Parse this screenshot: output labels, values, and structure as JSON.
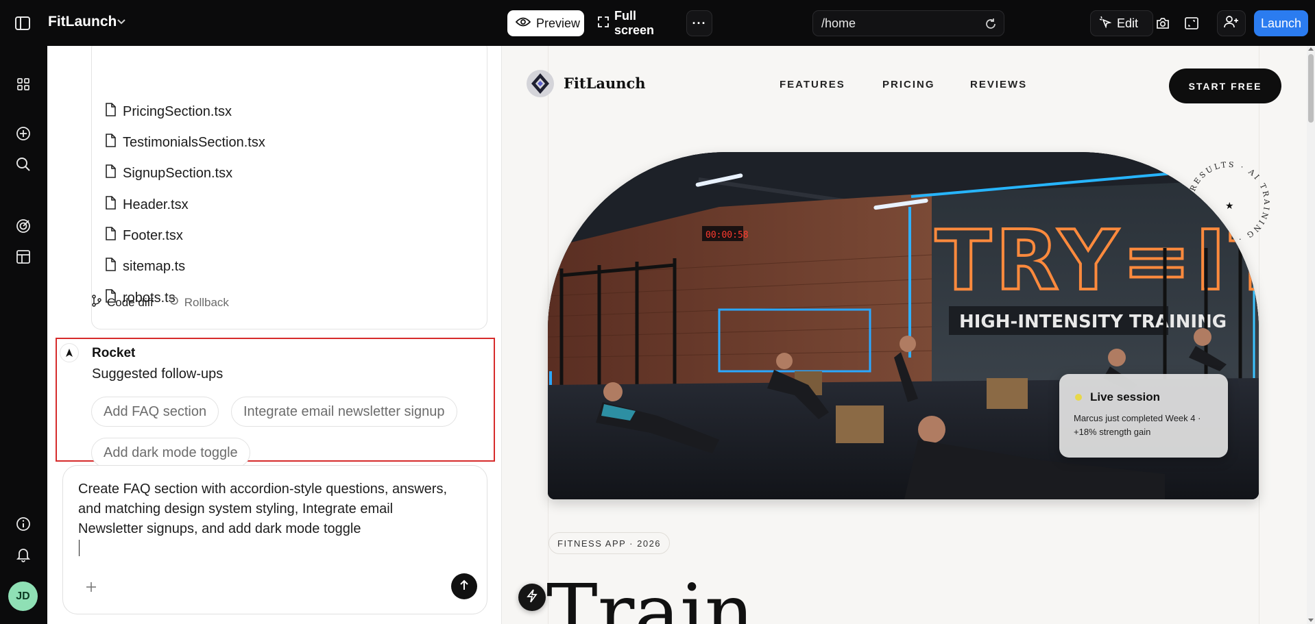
{
  "topbar": {
    "app_name": "FitLaunch",
    "preview_label": "Preview",
    "fullscreen_label": "Full screen",
    "url": "/home",
    "edit_label": "Edit",
    "launch_label": "Launch"
  },
  "user": {
    "initials": "JD"
  },
  "files": [
    "PricingSection.tsx",
    "TestimonialsSection.tsx",
    "SignupSection.tsx",
    "Header.tsx",
    "Footer.tsx",
    "sitemap.ts",
    "robots.ts"
  ],
  "file_actions": {
    "code_diff": "Code diff",
    "rollback": "Rollback"
  },
  "assistant": {
    "name": "Rocket",
    "suggested_title": "Suggested follow-ups",
    "suggestions": [
      "Add FAQ section",
      "Integrate email newsletter signup",
      "Add dark mode toggle"
    ]
  },
  "composer": {
    "text": "Create FAQ section with accordion-style questions, answers, and matching design system styling, Integrate email Newsletter signups, and add dark mode toggle"
  },
  "site": {
    "brand": "FitLaunch",
    "nav": [
      "FEATURES",
      "PRICING",
      "REVIEWS"
    ],
    "cta": "START FREE",
    "hero_sign": "TRY=IT",
    "hero_banner": "HIGH-INTENSITY TRAINING",
    "hero_timer": "00:00:58",
    "seal_text": "RESULTS · AI TRAINING ·",
    "live": {
      "title": "Live session",
      "text": "Marcus just completed Week 4 · +18% strength gain"
    },
    "year_badge": "FITNESS APP · 2026",
    "heading": "Train"
  },
  "colors": {
    "accent": "#2b7cf0",
    "highlight_border": "#d62b2b",
    "live_dot": "#e8d84a"
  }
}
